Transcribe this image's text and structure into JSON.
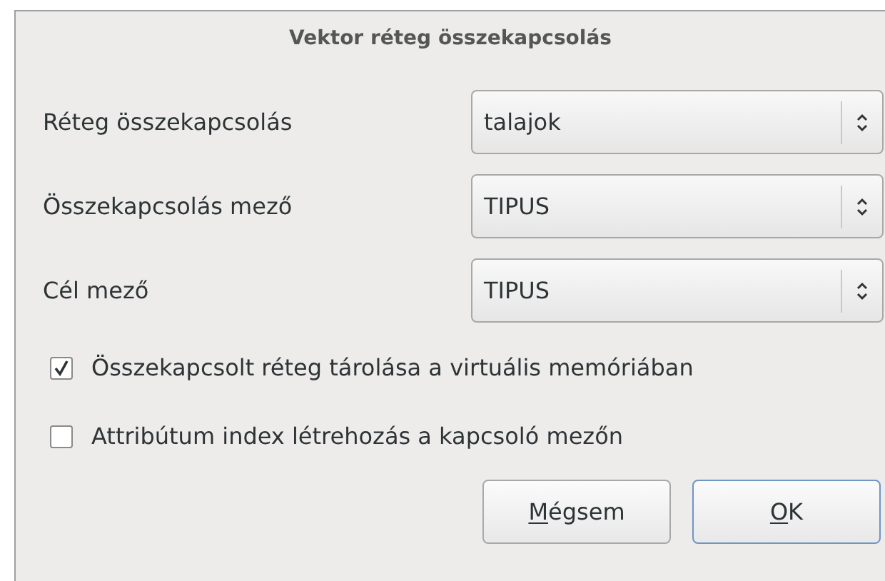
{
  "window": {
    "title": "Vektor réteg összekapcsolás"
  },
  "fields": [
    {
      "label": "Réteg összekapcsolás",
      "value": "talajok"
    },
    {
      "label": "Összekapcsolás mező",
      "value": "TIPUS"
    },
    {
      "label": "Cél mező",
      "value": "TIPUS"
    }
  ],
  "options": [
    {
      "label": "Összekapcsolt réteg tárolása a virtuális memóriában",
      "checked": true
    },
    {
      "label": "Attribútum index létrehozás a kapcsoló mezőn",
      "checked": false
    }
  ],
  "buttons": [
    {
      "label": "Mégsem",
      "mnemonic": true,
      "default": false
    },
    {
      "label": "OK",
      "mnemonic": true,
      "default": true
    }
  ]
}
